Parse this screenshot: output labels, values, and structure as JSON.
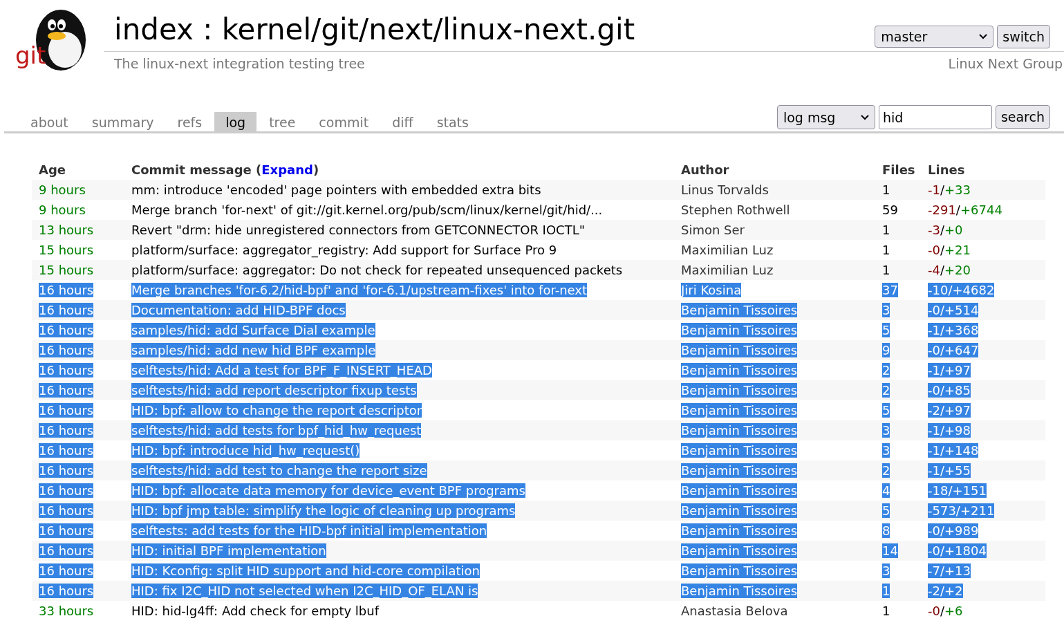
{
  "header": {
    "logo_text": "git",
    "title": "index : kernel/git/next/linux-next.git",
    "description": "The linux-next integration testing tree",
    "owner": "Linux Next Group",
    "branch_select": "master",
    "switch_button": "switch"
  },
  "tabs": [
    {
      "label": "about",
      "selected": false
    },
    {
      "label": "summary",
      "selected": false
    },
    {
      "label": "refs",
      "selected": false
    },
    {
      "label": "log",
      "selected": true
    },
    {
      "label": "tree",
      "selected": false
    },
    {
      "label": "commit",
      "selected": false
    },
    {
      "label": "diff",
      "selected": false
    },
    {
      "label": "stats",
      "selected": false
    }
  ],
  "search": {
    "mode": "log msg",
    "value": "hid",
    "button": "search"
  },
  "table": {
    "columns": {
      "age": "Age",
      "message": "Commit message",
      "expand_open": "(",
      "expand": "Expand",
      "expand_close": ")",
      "author": "Author",
      "files": "Files",
      "lines": "Lines"
    },
    "rows": [
      {
        "age": "9 hours",
        "message": "mm: introduce 'encoded' page pointers with embedded extra bits",
        "author": "Linus Torvalds",
        "files": "1",
        "lines": "-1/+33",
        "selected": false
      },
      {
        "age": "9 hours",
        "message": "Merge branch 'for-next' of git://git.kernel.org/pub/scm/linux/kernel/git/hid/...",
        "author": "Stephen Rothwell",
        "files": "59",
        "lines": "-291/+6744",
        "selected": false
      },
      {
        "age": "13 hours",
        "message": "Revert \"drm: hide unregistered connectors from GETCONNECTOR IOCTL\"",
        "author": "Simon Ser",
        "files": "1",
        "lines": "-3/+0",
        "selected": false
      },
      {
        "age": "15 hours",
        "message": "platform/surface: aggregator_registry: Add support for Surface Pro 9",
        "author": "Maximilian Luz",
        "files": "1",
        "lines": "-0/+21",
        "selected": false
      },
      {
        "age": "15 hours",
        "message": "platform/surface: aggregator: Do not check for repeated unsequenced packets",
        "author": "Maximilian Luz",
        "files": "1",
        "lines": "-4/+20",
        "selected": false
      },
      {
        "age": "16 hours",
        "message": "Merge branches 'for-6.2/hid-bpf' and 'for-6.1/upstream-fixes' into for-next",
        "author": "Jiri Kosina",
        "files": "37",
        "lines": "-10/+4682",
        "selected": true
      },
      {
        "age": "16 hours",
        "message": "Documentation: add HID-BPF docs",
        "author": "Benjamin Tissoires",
        "files": "3",
        "lines": "-0/+514",
        "selected": true
      },
      {
        "age": "16 hours",
        "message": "samples/hid: add Surface Dial example",
        "author": "Benjamin Tissoires",
        "files": "5",
        "lines": "-1/+368",
        "selected": true
      },
      {
        "age": "16 hours",
        "message": "samples/hid: add new hid BPF example",
        "author": "Benjamin Tissoires",
        "files": "9",
        "lines": "-0/+647",
        "selected": true
      },
      {
        "age": "16 hours",
        "message": "selftests/hid: Add a test for BPF_F_INSERT_HEAD",
        "author": "Benjamin Tissoires",
        "files": "2",
        "lines": "-1/+97",
        "selected": true
      },
      {
        "age": "16 hours",
        "message": "selftests/hid: add report descriptor fixup tests",
        "author": "Benjamin Tissoires",
        "files": "2",
        "lines": "-0/+85",
        "selected": true
      },
      {
        "age": "16 hours",
        "message": "HID: bpf: allow to change the report descriptor",
        "author": "Benjamin Tissoires",
        "files": "5",
        "lines": "-2/+97",
        "selected": true
      },
      {
        "age": "16 hours",
        "message": "selftests/hid: add tests for bpf_hid_hw_request",
        "author": "Benjamin Tissoires",
        "files": "3",
        "lines": "-1/+98",
        "selected": true
      },
      {
        "age": "16 hours",
        "message": "HID: bpf: introduce hid_hw_request()",
        "author": "Benjamin Tissoires",
        "files": "3",
        "lines": "-1/+148",
        "selected": true
      },
      {
        "age": "16 hours",
        "message": "selftests/hid: add test to change the report size",
        "author": "Benjamin Tissoires",
        "files": "2",
        "lines": "-1/+55",
        "selected": true
      },
      {
        "age": "16 hours",
        "message": "HID: bpf: allocate data memory for device_event BPF programs",
        "author": "Benjamin Tissoires",
        "files": "4",
        "lines": "-18/+151",
        "selected": true
      },
      {
        "age": "16 hours",
        "message": "HID: bpf jmp table: simplify the logic of cleaning up programs",
        "author": "Benjamin Tissoires",
        "files": "5",
        "lines": "-573/+211",
        "selected": true
      },
      {
        "age": "16 hours",
        "message": "selftests: add tests for the HID-bpf initial implementation",
        "author": "Benjamin Tissoires",
        "files": "8",
        "lines": "-0/+989",
        "selected": true
      },
      {
        "age": "16 hours",
        "message": "HID: initial BPF implementation",
        "author": "Benjamin Tissoires",
        "files": "14",
        "lines": "-0/+1804",
        "selected": true
      },
      {
        "age": "16 hours",
        "message": "HID: Kconfig: split HID support and hid-core compilation",
        "author": "Benjamin Tissoires",
        "files": "3",
        "lines": "-7/+13",
        "selected": true
      },
      {
        "age": "16 hours",
        "message": "HID: fix I2C_HID not selected when I2C_HID_OF_ELAN is",
        "author": "Benjamin Tissoires",
        "files": "1",
        "lines": "-2/+2",
        "selected": true
      },
      {
        "age": "33 hours",
        "message": "HID: hid-lg4ff: Add check for empty lbuf",
        "author": "Anastasia Belova",
        "files": "1",
        "lines": "-0/+6",
        "selected": false
      }
    ]
  }
}
